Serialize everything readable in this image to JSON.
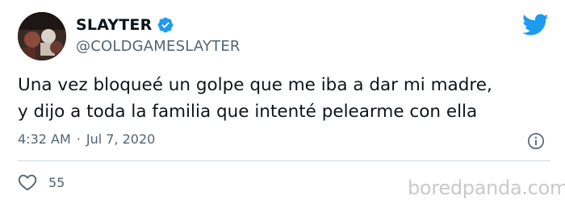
{
  "user": {
    "display_name": "SLAYTER",
    "handle": "@COLDGAMESLAYTER"
  },
  "tweet": {
    "text": "Una vez bloqueé un golpe que me iba a dar mi madre,\ny dijo a toda la familia que intenté pelearme con ella",
    "time": "4:32 AM",
    "separator": "·",
    "date": "Jul 7, 2020"
  },
  "engagement": {
    "likes": "55"
  },
  "watermark": "boredpanda.com",
  "colors": {
    "twitter_blue": "#1d9bf0",
    "secondary_text": "#536471",
    "divider": "#cfd9de"
  },
  "icons": {
    "brand": "twitter-bird-icon",
    "verified": "verified-badge-icon",
    "info": "info-icon",
    "like": "heart-icon"
  }
}
